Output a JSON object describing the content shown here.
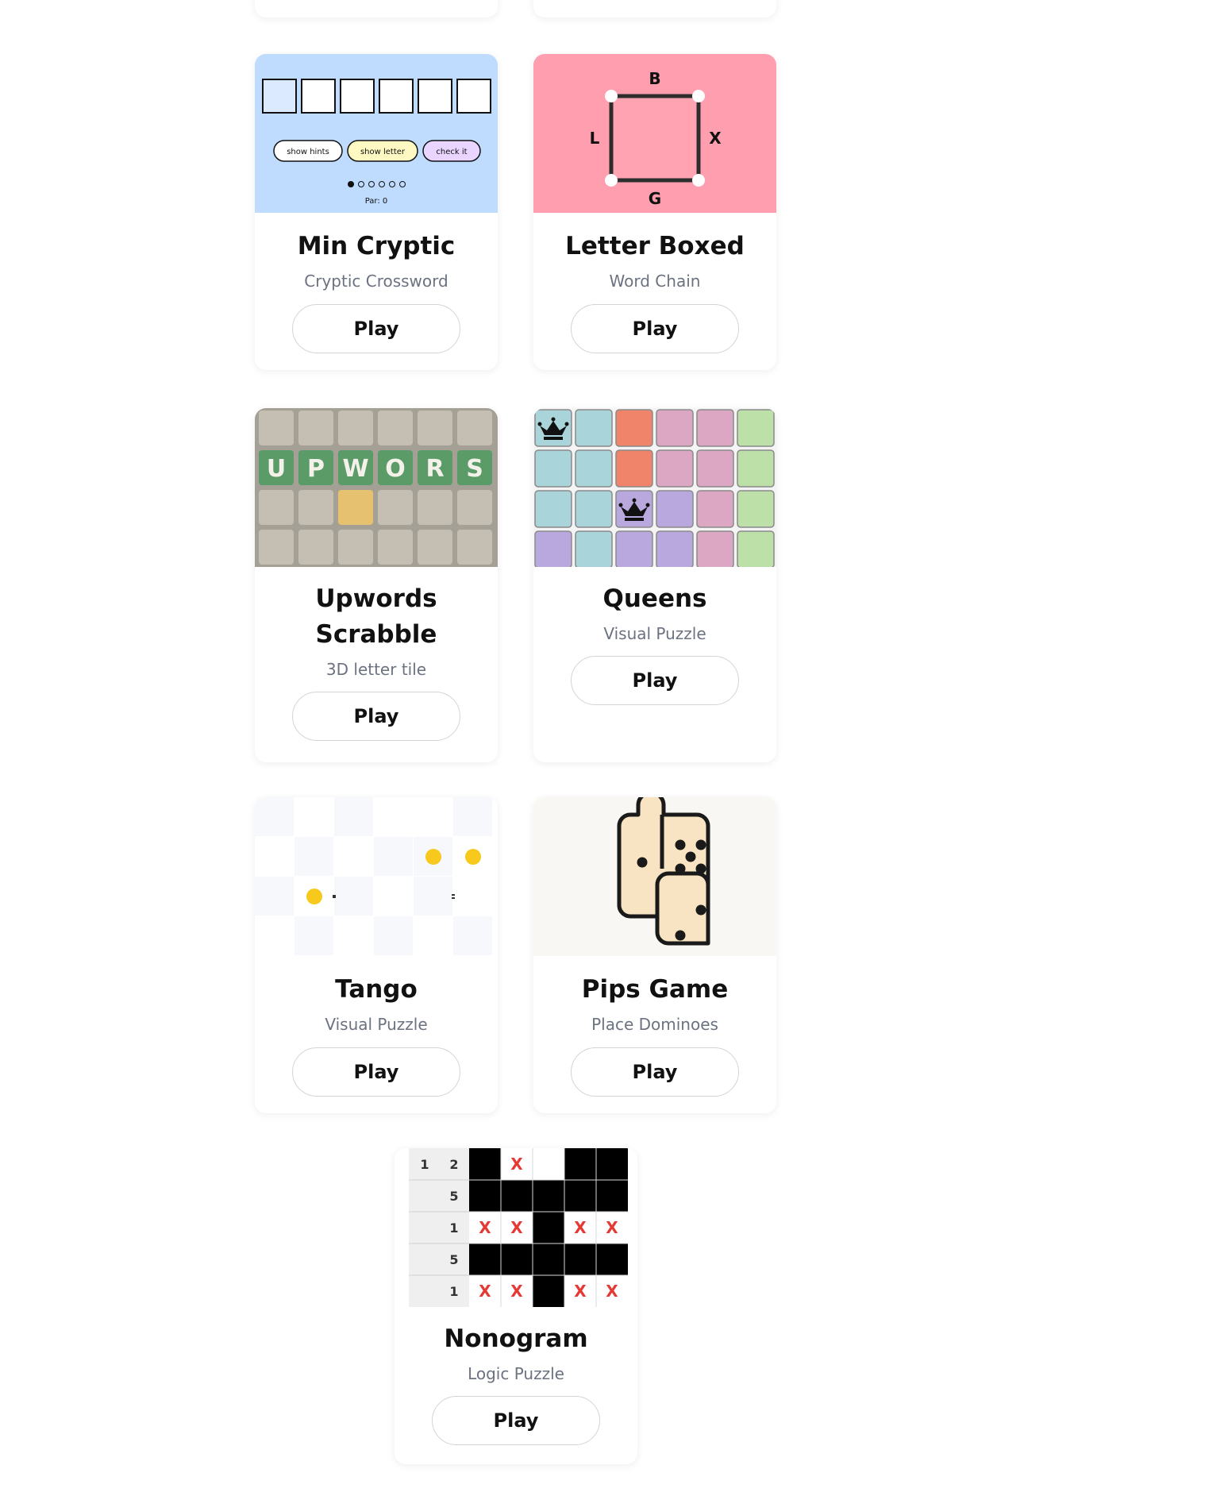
{
  "cards": [
    {
      "title": "Min Cryptic",
      "subtitle": "Cryptic Crossword",
      "play": "Play",
      "thumb": {
        "hints": "show hints",
        "letter": "show letter",
        "check": "check it",
        "par": "Par: 0"
      }
    },
    {
      "title": "Letter Boxed",
      "subtitle": "Word Chain",
      "play": "Play",
      "thumb": {
        "top": "B",
        "left": "L",
        "right": "X",
        "bottom": "G"
      }
    },
    {
      "title": "Upwords Scrabble",
      "subtitle": "3D letter tile",
      "play": "Play",
      "thumb": {
        "letters": [
          "U",
          "P",
          "W",
          "O",
          "R",
          "S"
        ]
      }
    },
    {
      "title": "Queens",
      "subtitle": "Visual Puzzle",
      "play": "Play",
      "thumb": {}
    },
    {
      "title": "Tango",
      "subtitle": "Visual Puzzle",
      "play": "Play",
      "thumb": {}
    },
    {
      "title": "Pips Game",
      "subtitle": "Place Dominoes",
      "play": "Play",
      "thumb": {}
    },
    {
      "title": "Nonogram",
      "subtitle": "Logic Puzzle",
      "play": "Play",
      "thumb": {
        "clues": [
          [
            "1",
            "2"
          ],
          [
            "5"
          ],
          [
            "1"
          ],
          [
            "5"
          ],
          [
            "1"
          ]
        ],
        "mark": "X"
      }
    }
  ],
  "colors": {
    "cryptic_bg": "#bfdbfe",
    "letterboxed_bg": "#ff9eae",
    "upwords_bg": "#a5a096",
    "upwords_green": "#5a9b68",
    "upwords_yellow": "#e6c170",
    "queens_blue": "#a9d4d9",
    "queens_orange": "#ef846b",
    "queens_pink": "#dba7c3",
    "queens_green": "#bde0a8",
    "queens_purple": "#b9a8de",
    "tango_sun": "#f7c91d",
    "tango_moon": "#a9c9e8",
    "pips_tile": "#f8e4c2",
    "nonogram_x": "#e53935"
  }
}
